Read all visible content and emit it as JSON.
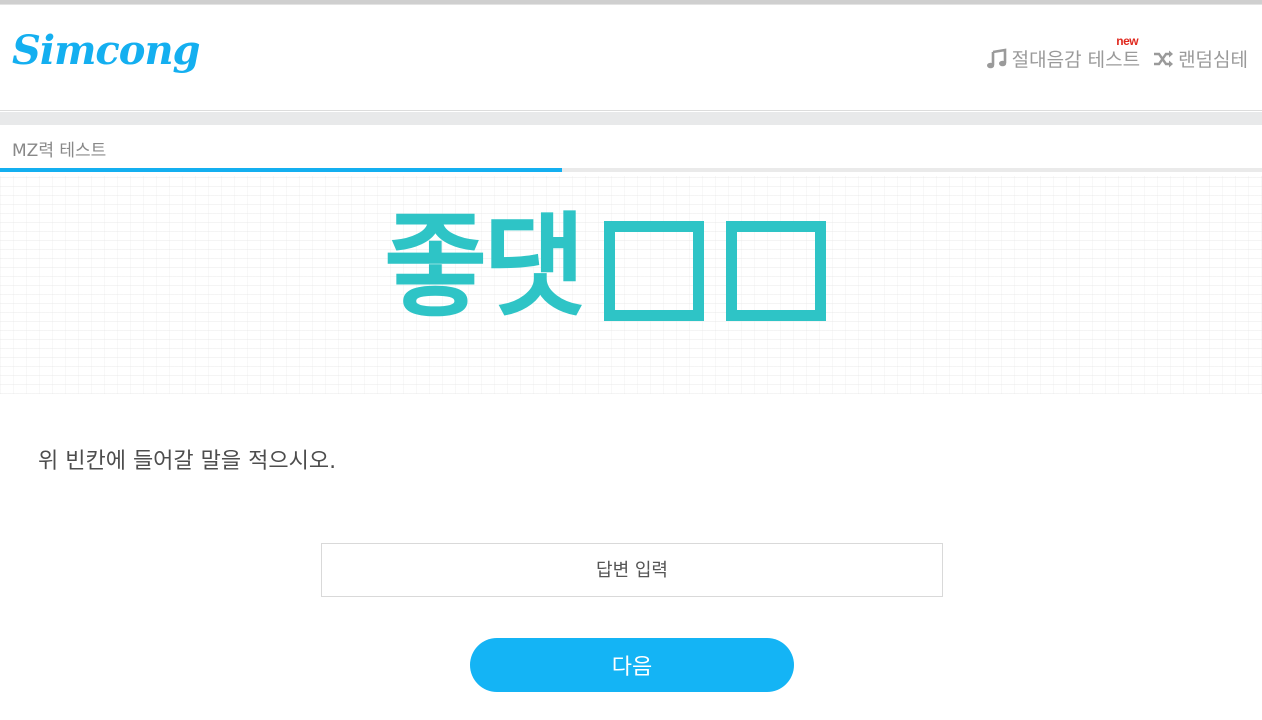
{
  "header": {
    "logo_text": "Simcong",
    "nav": [
      {
        "label": "절대음감 테스트",
        "icon": "music-note-icon",
        "badge": "new"
      },
      {
        "label": "랜덤심테",
        "icon": "shuffle-icon"
      }
    ]
  },
  "test": {
    "title": "MZ력 테스트",
    "progress": 0.445
  },
  "quiz": {
    "image_text": "좋댓",
    "blank_count": 2,
    "question": "위 빈칸에 들어갈 말을 적으시오.",
    "answer_placeholder": "답변 입력",
    "answer_value": "",
    "next_label": "다음"
  },
  "colors": {
    "brand": "#14aff0",
    "quiz_teal": "#2ec4c6",
    "badge_red": "#e0281e",
    "nav_gray": "#9a9a9a"
  }
}
